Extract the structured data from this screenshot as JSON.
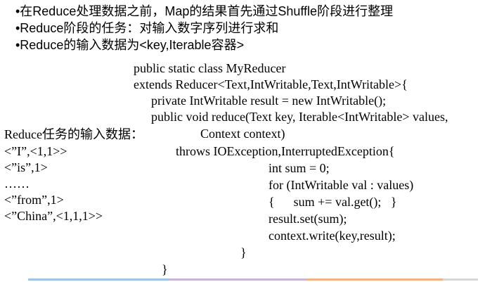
{
  "bullets": [
    "•在Reduce处理数据之前，Map的结果首先通过Shuffle阶段进行整理",
    "•Reduce阶段的任务：对输入数字序列进行求和",
    "•Reduce的输入数据为<key,Iterable容器>"
  ],
  "code": {
    "lines": [
      "public static class MyReducer",
      "extends Reducer<Text,IntWritable,Text,IntWritable>{",
      "private IntWritable result = new IntWritable();",
      "public void reduce(Text key, Iterable<IntWritable> values,",
      "Context context)",
      "throws IOException,InterruptedException{",
      "int sum = 0;",
      "for (IntWritable val : values)",
      "{      sum += val.get();   }",
      "result.set(sum);",
      "context.write(key,result);",
      "}",
      "}"
    ]
  },
  "reduce_input": {
    "title": "Reduce任务的输入数据：",
    "lines": [
      "<”I”,<1,1>>",
      "<”is”,1>",
      "……",
      "<”from”,1>",
      "<”China”,<1,1,1>>"
    ]
  },
  "footer": {
    "colors": [
      "#9dc3e6",
      "#c9b3d6",
      "#f4b183",
      "#d6d6d6"
    ]
  }
}
